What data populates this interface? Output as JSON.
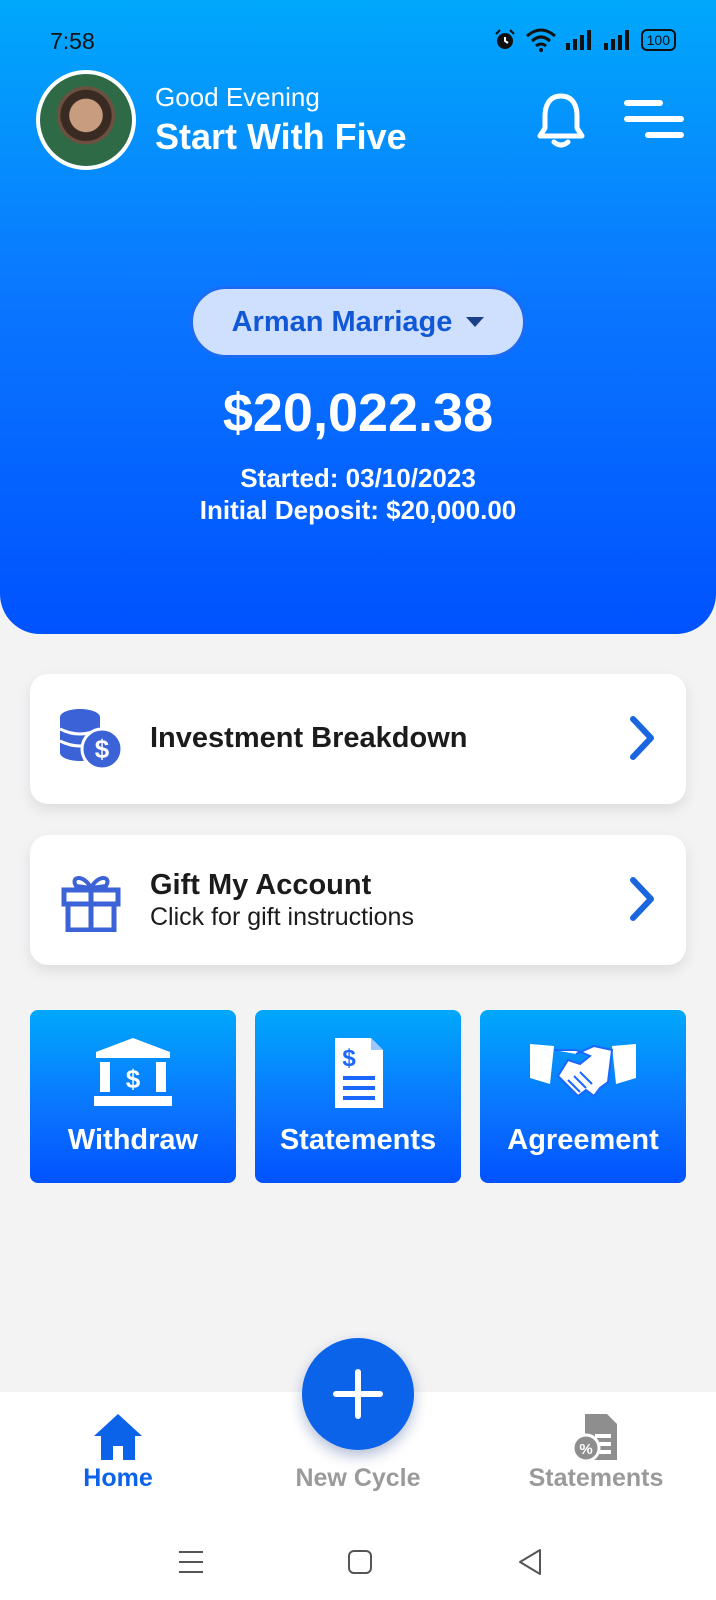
{
  "status_bar": {
    "time": "7:58",
    "battery": "100",
    "icons": [
      "alarm-icon",
      "wifi-icon",
      "signal-icon",
      "signal-icon",
      "battery-icon"
    ]
  },
  "header": {
    "greeting": "Good Evening",
    "user_name": "Start With Five",
    "bell_icon": "bell-icon",
    "menu_icon": "menu-icon"
  },
  "account": {
    "selected_goal": "Arman Marriage",
    "balance": "$20,022.38",
    "started": "Started: 03/10/2023",
    "initial_deposit": "Initial Deposit:  $20,000.00"
  },
  "cards": [
    {
      "title": "Investment Breakdown",
      "icon": "coins-dollar-icon"
    },
    {
      "title": "Gift My Account",
      "subtitle": "Click for gift  instructions",
      "icon": "gift-icon"
    }
  ],
  "tiles": [
    {
      "label": "Withdraw",
      "icon": "bank-icon"
    },
    {
      "label": "Statements",
      "icon": "document-dollar-icon"
    },
    {
      "label": "Agreement",
      "icon": "handshake-icon"
    }
  ],
  "bottom_nav": {
    "items": [
      {
        "label": "Home",
        "icon": "home-icon",
        "active": true
      },
      {
        "label": "New Cycle",
        "icon": "plus-icon",
        "active": false
      },
      {
        "label": "Statements",
        "icon": "statements-icon",
        "active": false
      }
    ]
  },
  "colors": {
    "primary": "#0b63ea",
    "gradient_top": "#00a8fb",
    "gradient_bottom": "#0052ff",
    "inactive": "#9a9a9a",
    "pill_bg": "#cfe0ff"
  }
}
